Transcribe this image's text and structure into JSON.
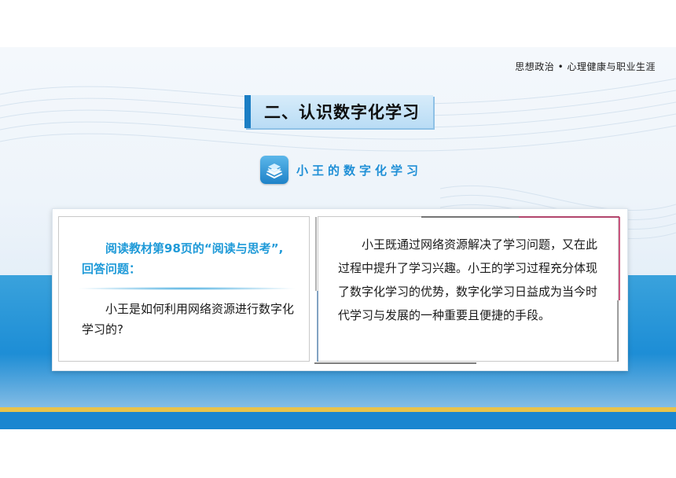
{
  "header": {
    "subject": "思想政治 • 心理健康与职业生涯"
  },
  "section": {
    "title": "二、认识数字化学习"
  },
  "subsection": {
    "title": "小王的数字化学习",
    "icon": "book-stack-icon"
  },
  "question_card": {
    "prompt": "阅读教材第98页的“阅读与思考”, 回答问题：",
    "question": "小王是如何利用网络资源进行数字化学习的?"
  },
  "answer_card": {
    "answer": "小王既通过网络资源解决了学习问题，又在此过程中提升了学习兴趣。小王的学习过程充分体现了数字化学习的优势，数字化学习日益成为当今时代学习与发展的一种重要且便捷的手段。"
  },
  "colors": {
    "accent": "#1f8fd6",
    "title_bar": "#1b7ec4",
    "gold_stripe": "#e9c34a",
    "prompt_text": "#1f9ad8"
  }
}
